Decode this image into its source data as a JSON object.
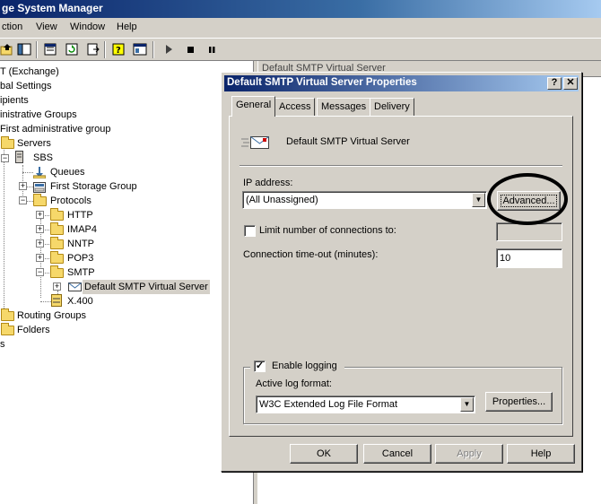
{
  "main_window": {
    "title": "ge System Manager"
  },
  "menubar": [
    "ction",
    "View",
    "Window",
    "Help"
  ],
  "toolbar": {
    "icons": [
      "up-folder-icon",
      "show-tree-icon",
      "properties-icon",
      "refresh-icon",
      "export-icon",
      "help-icon",
      "mmc-icon",
      "start-icon",
      "stop-icon",
      "pause-icon"
    ]
  },
  "tree": {
    "nodes": [
      {
        "label": "T (Exchange)"
      },
      {
        "label": "bal Settings"
      },
      {
        "label": "ipients"
      },
      {
        "label": "inistrative Groups"
      },
      {
        "label": "First administrative group"
      },
      {
        "label": "Servers"
      },
      {
        "label": "SBS"
      },
      {
        "label": "Queues"
      },
      {
        "label": "First Storage Group"
      },
      {
        "label": "Protocols"
      },
      {
        "label": "HTTP"
      },
      {
        "label": "IMAP4"
      },
      {
        "label": "NNTP"
      },
      {
        "label": "POP3"
      },
      {
        "label": "SMTP"
      },
      {
        "label": "Default SMTP Virtual Server"
      },
      {
        "label": "X.400"
      },
      {
        "label": "Routing Groups"
      },
      {
        "label": "Folders"
      },
      {
        "label": "s"
      }
    ]
  },
  "right_pane": {
    "header": "Default SMTP Virtual Server"
  },
  "dialog": {
    "title": "Default SMTP Virtual Server Properties",
    "help_btn": "?",
    "close_btn": "✕",
    "tabs": [
      {
        "label": "General",
        "active": true
      },
      {
        "label": "Access"
      },
      {
        "label": "Messages"
      },
      {
        "label": "Delivery"
      }
    ],
    "server_name": "Default SMTP Virtual Server",
    "ip_address_label": "IP address:",
    "ip_address_value": "(All Unassigned)",
    "advanced_button": "Advanced...",
    "limit_connections_label": "Limit number of connections to:",
    "limit_connections_checked": false,
    "limit_connections_value": "",
    "timeout_label": "Connection time-out (minutes):",
    "timeout_value": "10",
    "enable_logging_label": "Enable logging",
    "enable_logging_checked": true,
    "log_format_label": "Active log format:",
    "log_format_value": "W3C Extended Log File Format",
    "properties_button": "Properties...",
    "ok_button": "OK",
    "cancel_button": "Cancel",
    "apply_button": "Apply",
    "help_button": "Help"
  },
  "colors": {
    "title_bar": "#0a246a",
    "dialog_face": "#d4d0c8",
    "selection": "#d4d0c8"
  }
}
